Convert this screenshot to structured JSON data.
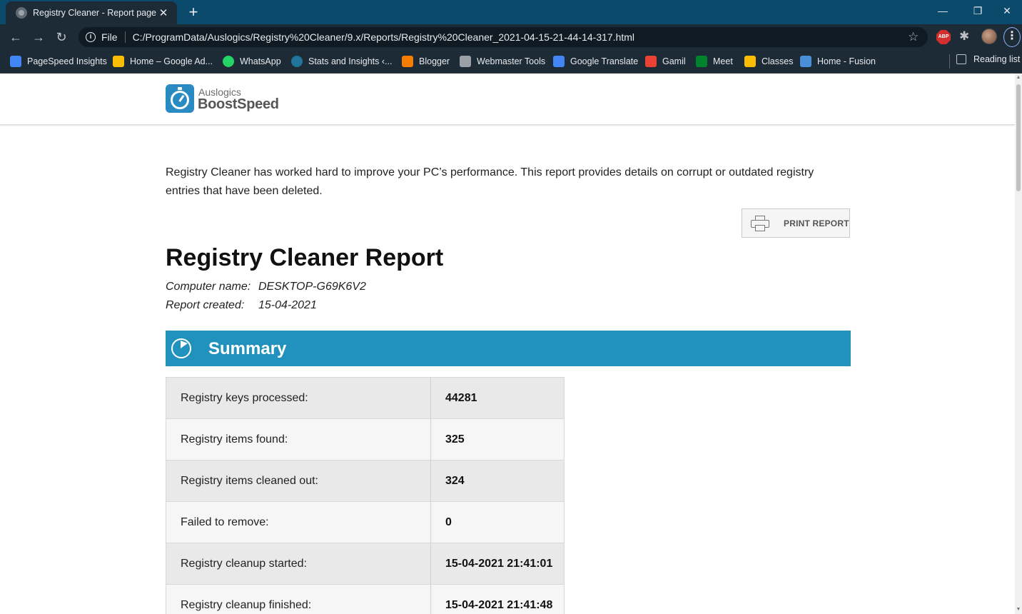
{
  "browser": {
    "tab_title": "Registry Cleaner - Report page",
    "tab_close": "✕",
    "new_tab": "+",
    "window_controls": {
      "minimize": "—",
      "restore": "❐",
      "close": "✕"
    },
    "nav": {
      "back": "←",
      "forward": "→",
      "reload": "↻"
    },
    "address": {
      "info": "i",
      "scheme_label": "File",
      "url": "C:/ProgramData/Auslogics/Registry%20Cleaner/9.x/Reports/Registry%20Cleaner_2021-04-15-21-44-14-317.html"
    },
    "icons": {
      "star": "☆",
      "abp": "ABP",
      "extensions": "✱",
      "menu": "⋮"
    },
    "bookmarks": [
      {
        "label": "PageSpeed Insights",
        "color": "#4285f4"
      },
      {
        "label": "Home – Google Ad...",
        "color": "#fbbc04"
      },
      {
        "label": "WhatsApp",
        "color": "#25d366"
      },
      {
        "label": "Stats and Insights ‹...",
        "color": "#21759b"
      },
      {
        "label": "Blogger",
        "color": "#f57d00"
      },
      {
        "label": "Webmaster Tools",
        "color": "#9aa0a6"
      },
      {
        "label": "Google Translate",
        "color": "#4285f4"
      },
      {
        "label": "Gamil",
        "color": "#ea4335"
      },
      {
        "label": "Meet",
        "color": "#00832d"
      },
      {
        "label": "Classes",
        "color": "#fbbc04"
      },
      {
        "label": "Home - Fusion",
        "color": "#4a90d9"
      }
    ],
    "reading_list": "Reading list"
  },
  "header": {
    "brand_small": "Auslogics",
    "brand_large": "BoostSpeed"
  },
  "intro": "Registry Cleaner has worked hard to improve your PC’s performance. This report provides details on corrupt or outdated registry entries that have been deleted.",
  "print_button": "PRINT REPORT",
  "report": {
    "title": "Registry Cleaner Report",
    "computer_name_label": "Computer name:",
    "computer_name": "DESKTOP-G69K6V2",
    "report_created_label": "Report created:",
    "report_created": "15-04-2021"
  },
  "summary": {
    "title": "Summary",
    "rows": [
      {
        "label": "Registry keys processed:",
        "value": "44281"
      },
      {
        "label": "Registry items found:",
        "value": "325"
      },
      {
        "label": "Registry items cleaned out:",
        "value": "324"
      },
      {
        "label": "Failed to remove:",
        "value": "0"
      },
      {
        "label": "Registry cleanup started:",
        "value": "15-04-2021 21:41:01"
      },
      {
        "label": "Registry cleanup finished:",
        "value": "15-04-2021 21:41:48"
      }
    ]
  }
}
